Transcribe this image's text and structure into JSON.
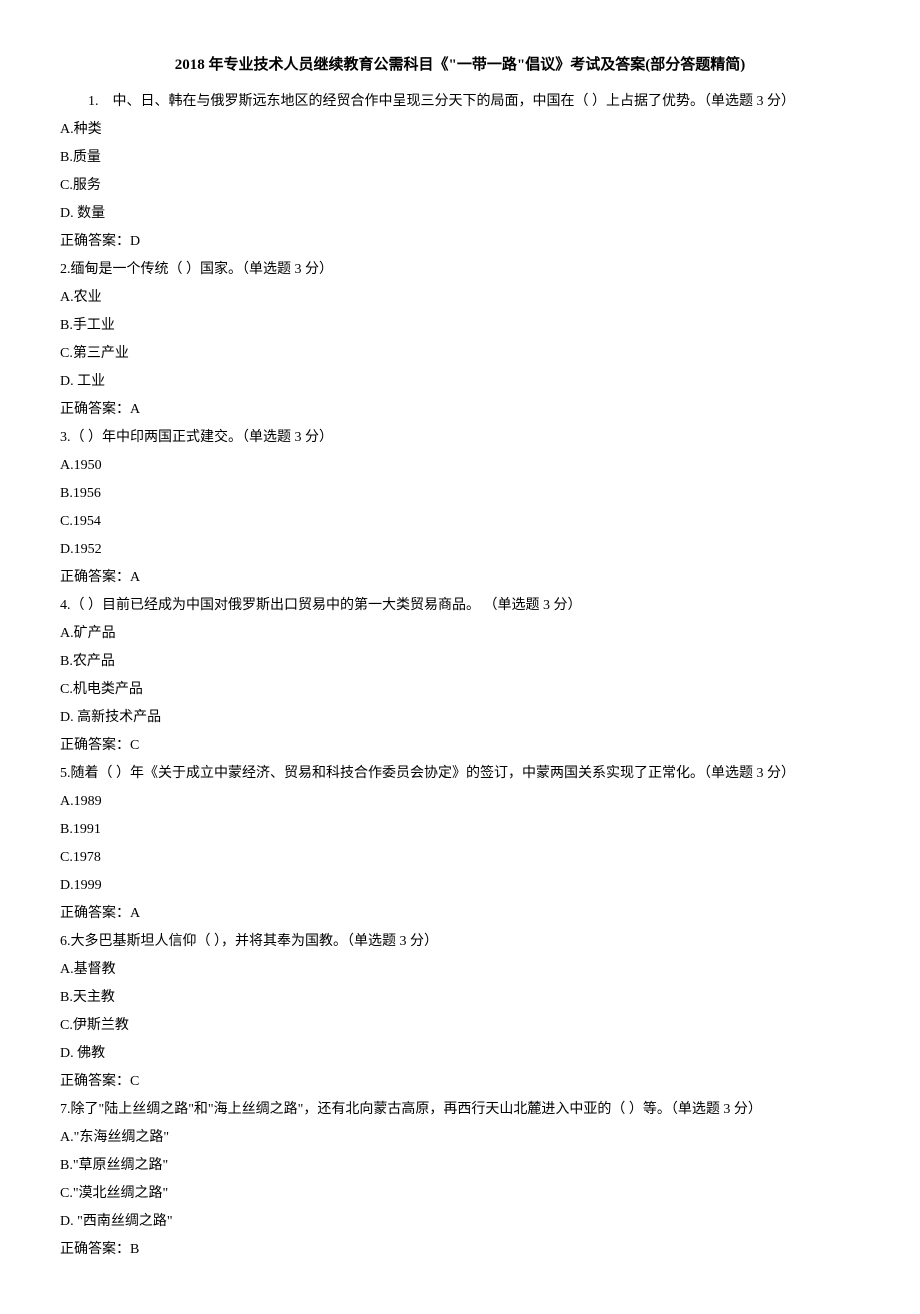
{
  "title": "2018 年专业技术人员继续教育公需科目《\"一带一路\"倡议》考试及答案(部分答题精简)",
  "questions": [
    {
      "num": "1.",
      "stem": "中、日、韩在与俄罗斯远东地区的经贸合作中呈现三分天下的局面，中国在（ ）上占据了优势。（单选题 3 分）",
      "opts": [
        "A.种类",
        "B.质量",
        "C.服务",
        "D. 数量"
      ],
      "ans": "正确答案：D"
    },
    {
      "num": "2.",
      "stem": "缅甸是一个传统（ ）国家。（单选题 3 分）",
      "opts": [
        "A.农业",
        "B.手工业",
        "C.第三产业",
        "D. 工业"
      ],
      "ans": "正确答案：A"
    },
    {
      "num": "3.",
      "stem": "（ ）年中印两国正式建交。（单选题 3 分）",
      "opts": [
        "A.1950",
        "B.1956",
        "C.1954",
        "D.1952"
      ],
      "ans": "正确答案：A"
    },
    {
      "num": "4.",
      "stem": "（ ）目前已经成为中国对俄罗斯出口贸易中的第一大类贸易商品。 （单选题 3 分）",
      "opts": [
        "A.矿产品",
        "B.农产品",
        "C.机电类产品",
        "D. 高新技术产品"
      ],
      "ans": "正确答案：C"
    },
    {
      "num": "5.",
      "stem": "随着（ ）年《关于成立中蒙经济、贸易和科技合作委员会协定》的签订，中蒙两国关系实现了正常化。（单选题 3 分）",
      "opts": [
        "A.1989",
        "B.1991",
        "C.1978",
        "D.1999"
      ],
      "ans": "正确答案：A"
    },
    {
      "num": "6.",
      "stem": "大多巴基斯坦人信仰（ ），并将其奉为国教。（单选题 3 分）",
      "opts": [
        "A.基督教",
        "B.天主教",
        "C.伊斯兰教",
        "D. 佛教"
      ],
      "ans": "正确答案：C"
    },
    {
      "num": "7.",
      "stem": "除了\"陆上丝绸之路\"和\"海上丝绸之路\"，还有北向蒙古高原，再西行天山北麓进入中亚的（ ）等。（单选题 3 分）",
      "opts": [
        "A.\"东海丝绸之路\"",
        "B.\"草原丝绸之路\"",
        "C.\"漠北丝绸之路\"",
        "D. \"西南丝绸之路\""
      ],
      "ans": "正确答案：B"
    }
  ]
}
